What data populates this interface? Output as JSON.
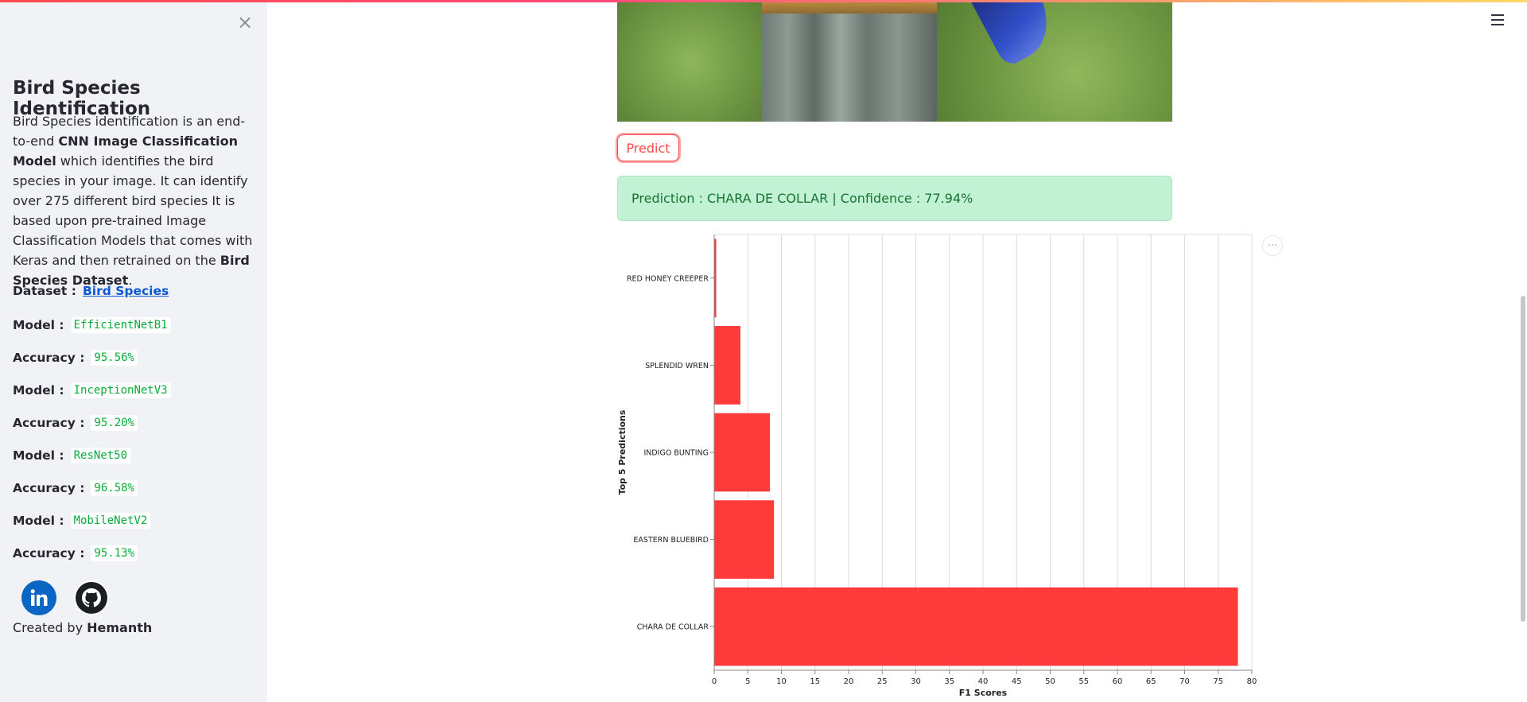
{
  "sidebar": {
    "close_label": "×",
    "title": "Bird Species Identification",
    "description": [
      {
        "t": "Bird Species identification is an end-to-end ",
        "b": false
      },
      {
        "t": "CNN Image Classification Model",
        "b": true
      },
      {
        "t": " which identifies the bird species in your image. It can identify over 275 different bird species It is based upon pre-trained Image Classification Models that comes with Keras and then retrained on the ",
        "b": false
      },
      {
        "t": "Bird Species Dataset",
        "b": true
      },
      {
        "t": ".",
        "b": false
      }
    ],
    "dataset_label": "Dataset :",
    "dataset_link": "Bird Species",
    "rows": [
      {
        "label": "Model :",
        "value": "EfficientNetB1"
      },
      {
        "label": "Accuracy :",
        "value": "95.56%"
      },
      {
        "label": "Model :",
        "value": "InceptionNetV3"
      },
      {
        "label": "Accuracy :",
        "value": "95.20%"
      },
      {
        "label": "Model :",
        "value": "ResNet50"
      },
      {
        "label": "Accuracy :",
        "value": "96.58%"
      },
      {
        "label": "Model :",
        "value": "MobileNetV2"
      },
      {
        "label": "Accuracy :",
        "value": "95.13%"
      }
    ],
    "social": {
      "linkedin_icon": "linkedin-icon",
      "github_icon": "github-icon"
    },
    "created_prefix": "Created by ",
    "created_name": "Hemanth"
  },
  "main": {
    "menu_icon": "hamburger-menu-icon",
    "predict_label": "Predict",
    "prediction_text": "Prediction : CHARA DE COLLAR | Confidence : 77.94%",
    "chart_menu_label": "⋯"
  },
  "colors": {
    "accent": "#ff4b4b",
    "bar": "#ff3a3a",
    "success_bg": "#c2f2d4",
    "success_text": "#177233",
    "code_text": "#09ab3b"
  },
  "chart_data": {
    "type": "bar",
    "orientation": "horizontal",
    "categories": [
      "RED HONEY CREEPER",
      "SPLENDID WREN",
      "INDIGO BUNTING",
      "EASTERN BLUEBIRD",
      "CHARA DE COLLAR"
    ],
    "values": [
      0.3,
      3.9,
      8.3,
      8.9,
      77.94
    ],
    "xlabel": "F1 Scores",
    "ylabel": "Top 5 Predictions",
    "xlim": [
      0,
      80
    ],
    "xticks": [
      0,
      5,
      10,
      15,
      20,
      25,
      30,
      35,
      40,
      45,
      50,
      55,
      60,
      65,
      70,
      75,
      80
    ],
    "grid": true
  }
}
